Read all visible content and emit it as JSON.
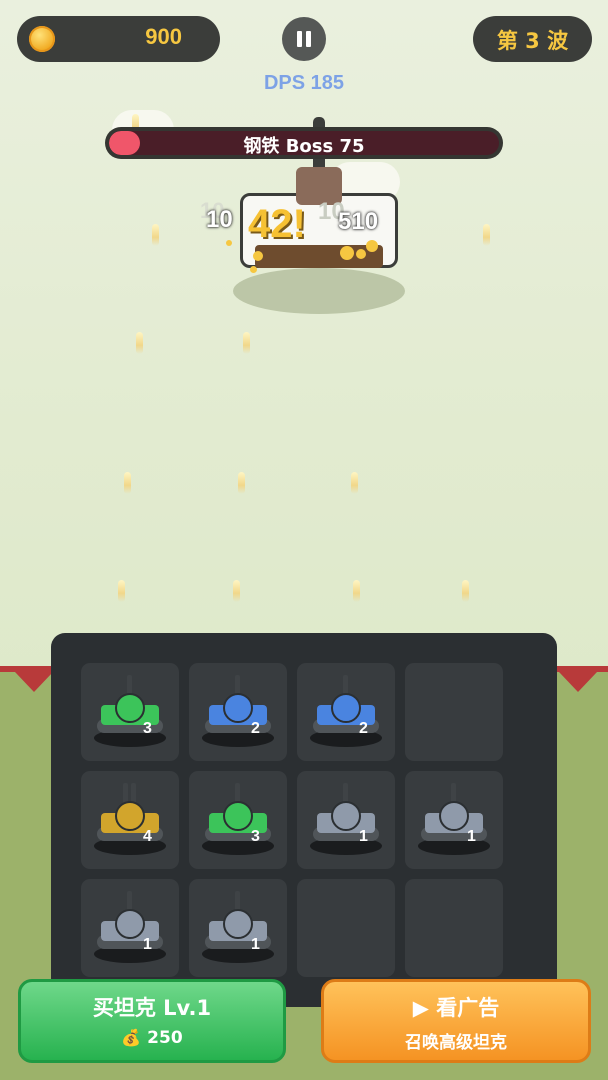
{
  "hud": {
    "coins": "900",
    "coin_icon": "coin-icon",
    "pause_icon": "pause-icon",
    "wave": "第 3 波"
  },
  "dps": "DPS 185",
  "boss": {
    "name": "钢铁 Boss 75",
    "health_fraction": 0.08,
    "health_color": "#f0566a"
  },
  "damage_numbers": {
    "big": "42!",
    "left": "10",
    "right": "510",
    "ghost_left": "10",
    "ghost_right": "10"
  },
  "grid": {
    "rows": [
      [
        {
          "color": "green",
          "level": "3"
        },
        {
          "color": "blue",
          "level": "2"
        },
        {
          "color": "blue",
          "level": "2"
        },
        null
      ],
      [
        {
          "color": "gold",
          "level": "4"
        },
        {
          "color": "green",
          "level": "3"
        },
        {
          "color": "gray",
          "level": "1"
        },
        {
          "color": "gray",
          "level": "1"
        }
      ],
      [
        {
          "color": "gray",
          "level": "1"
        },
        {
          "color": "gray",
          "level": "1"
        },
        null,
        null
      ]
    ],
    "colors": {
      "green": "#3cc45a",
      "blue": "#4a84e0",
      "gold": "#d2a52c",
      "gray": "#8f9aaa"
    }
  },
  "buttons": {
    "buy": {
      "title": "买坦克 Lv.1",
      "cost": "250",
      "icon": "money-bag-icon"
    },
    "ad": {
      "title": "看广告",
      "subtitle": "召唤高级坦克",
      "icon": "play-icon"
    }
  }
}
